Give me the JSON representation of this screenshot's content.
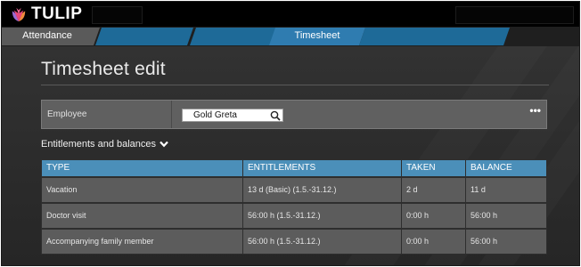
{
  "brand": {
    "name": "TULIP",
    "icon": "tulip-logo-icon",
    "colors": [
      "#e8467a",
      "#9c6ad4",
      "#f08a3c"
    ]
  },
  "tabs": [
    {
      "label": "Attendance",
      "active": false,
      "color": "#5a5a5a"
    },
    {
      "label": "",
      "active": false,
      "color": "#1e6a98"
    },
    {
      "label": "",
      "active": false,
      "color": "#1e6a98"
    },
    {
      "label": "Timesheet",
      "active": true,
      "color": "#2f7cb0"
    },
    {
      "label": "",
      "active": false,
      "color": "#1e6a98"
    }
  ],
  "page": {
    "title": "Timesheet edit"
  },
  "employee": {
    "label": "Employee",
    "value": "Gold Greta",
    "search_icon": "search-icon",
    "more_label": "•••"
  },
  "entitlements": {
    "heading": "Entitlements and balances",
    "toggle_icon": "chevron-down-icon",
    "columns": [
      "TYPE",
      "ENTITLEMENTS",
      "TAKEN",
      "BALANCE"
    ],
    "rows": [
      [
        "Vacation",
        "13 d (Basic) (1.5.-31.12.)",
        "2 d",
        "11 d"
      ],
      [
        "Doctor visit",
        "56:00 h (1.5.-31.12.)",
        "0:00 h",
        "56:00 h"
      ],
      [
        "Accompanying family member",
        "56:00 h (1.5.-31.12.)",
        "0:00 h",
        "56:00 h"
      ]
    ]
  },
  "colors": {
    "header_bg": "#000000",
    "table_header": "#4b8fb9",
    "row_bg": "#5c5c5c",
    "panel_bg": "#2b2b2b"
  }
}
